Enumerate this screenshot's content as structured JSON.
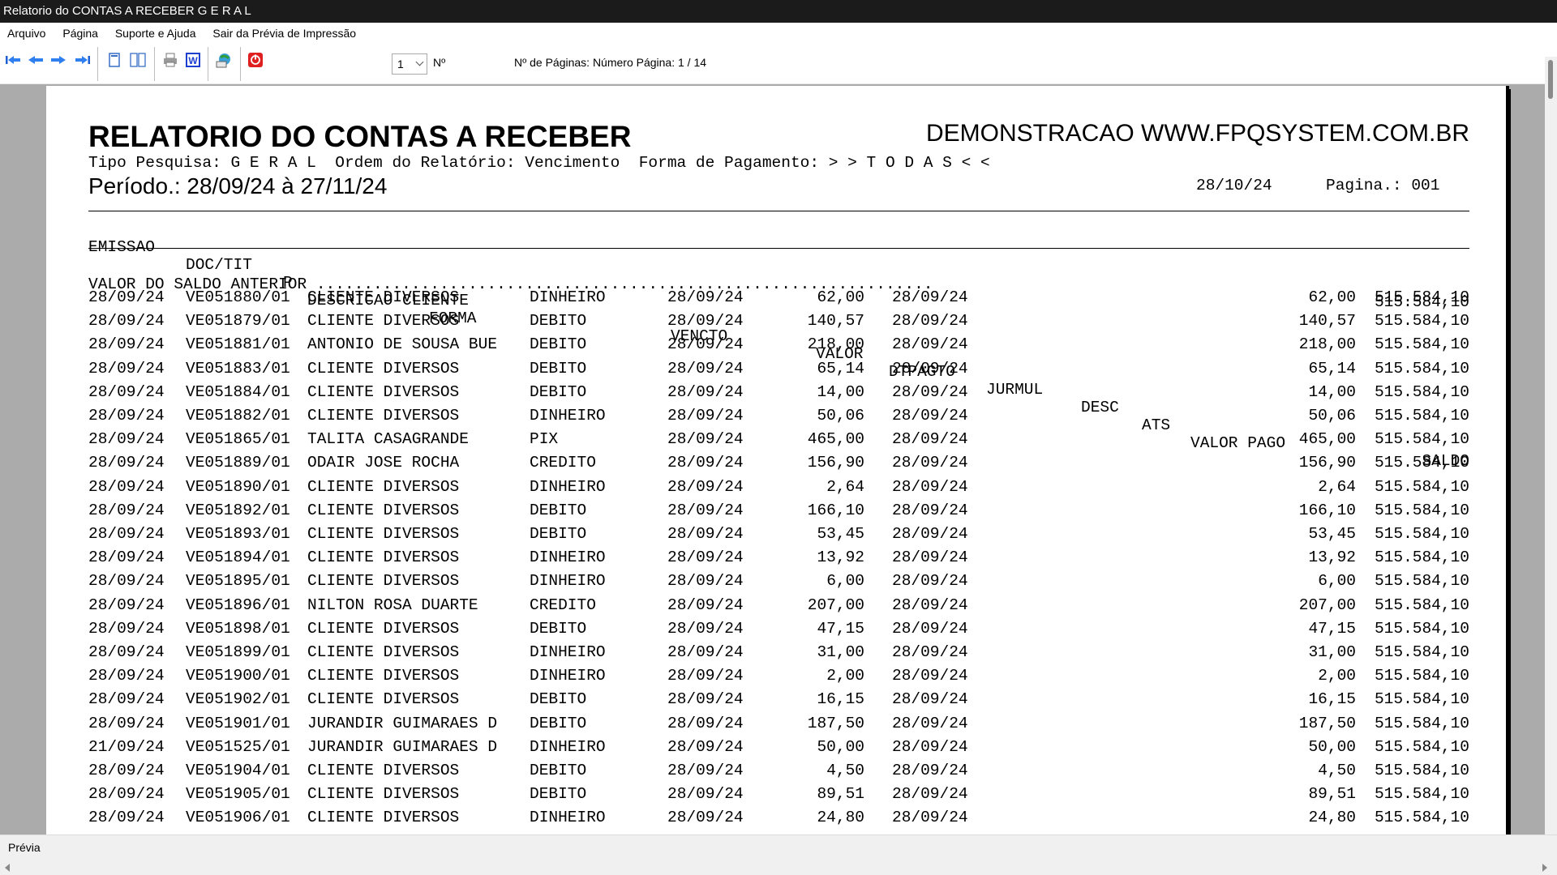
{
  "window": {
    "title": "Relatorio do CONTAS A RECEBER G E R A L"
  },
  "menu": [
    "Arquivo",
    "Página",
    "Suporte e Ajuda",
    "Sair da Prévia de Impressão"
  ],
  "toolbar": {
    "icons": [
      "first-page-icon",
      "prev-page-icon",
      "next-page-icon",
      "last-page-icon",
      "single-page-icon",
      "two-pages-icon",
      "print-icon",
      "word-export-icon",
      "email-export-icon",
      "close-preview-icon"
    ],
    "page_select_value": "1",
    "n_label": "Nº",
    "pages_info": "Nº de Páginas: Número Página: 1 / 14"
  },
  "status": {
    "text": "Prévia"
  },
  "report": {
    "title": "RELATORIO DO CONTAS A RECEBER",
    "company": "DEMONSTRACAO WWW.FPQSYSTEM.COM.BR",
    "line2": "Tipo Pesquisa: G E R A L  Ordem do Relatório: Vencimento  Forma de Pagamento: > > T O D A S < <",
    "periodo": "Período.: 28/09/24 à 27/11/24",
    "date": "28/10/24",
    "pagina": "Pagina.: 001",
    "columns": {
      "emissao": "EMISSAO",
      "doc": "DOC/TIT",
      "p": "P",
      "descricao": "DESCRICAO CLIENTE",
      "forma": "FORMA",
      "vencto": "VENCTO",
      "valor": "VALOR",
      "dtpagto": "DTPAGTO",
      "jurmul": "JURMUL",
      "desc": "DESC",
      "ats": "ATS",
      "valor_pago": "VALOR PAGO",
      "saldo": "SALDO"
    },
    "saldo_anterior": {
      "label": "VALOR DO SALDO ANTERIOR .................................................................",
      "value": "515.584,10"
    },
    "rows": [
      [
        "28/09/24",
        "VE051880/01",
        "CLIENTE DIVERSOS",
        "DINHEIRO",
        "28/09/24",
        "62,00",
        "28/09/24",
        "62,00",
        "515.584,10"
      ],
      [
        "28/09/24",
        "VE051879/01",
        "CLIENTE DIVERSOS",
        "DEBITO",
        "28/09/24",
        "140,57",
        "28/09/24",
        "140,57",
        "515.584,10"
      ],
      [
        "28/09/24",
        "VE051881/01",
        "ANTONIO DE SOUSA BUE",
        "DEBITO",
        "28/09/24",
        "218,00",
        "28/09/24",
        "218,00",
        "515.584,10"
      ],
      [
        "28/09/24",
        "VE051883/01",
        "CLIENTE DIVERSOS",
        "DEBITO",
        "28/09/24",
        "65,14",
        "28/09/24",
        "65,14",
        "515.584,10"
      ],
      [
        "28/09/24",
        "VE051884/01",
        "CLIENTE DIVERSOS",
        "DEBITO",
        "28/09/24",
        "14,00",
        "28/09/24",
        "14,00",
        "515.584,10"
      ],
      [
        "28/09/24",
        "VE051882/01",
        "CLIENTE DIVERSOS",
        "DINHEIRO",
        "28/09/24",
        "50,06",
        "28/09/24",
        "50,06",
        "515.584,10"
      ],
      [
        "28/09/24",
        "VE051865/01",
        "TALITA CASAGRANDE",
        "PIX",
        "28/09/24",
        "465,00",
        "28/09/24",
        "465,00",
        "515.584,10"
      ],
      [
        "28/09/24",
        "VE051889/01",
        "ODAIR JOSE ROCHA",
        "CREDITO",
        "28/09/24",
        "156,90",
        "28/09/24",
        "156,90",
        "515.584,10"
      ],
      [
        "28/09/24",
        "VE051890/01",
        "CLIENTE DIVERSOS",
        "DINHEIRO",
        "28/09/24",
        "2,64",
        "28/09/24",
        "2,64",
        "515.584,10"
      ],
      [
        "28/09/24",
        "VE051892/01",
        "CLIENTE DIVERSOS",
        "DEBITO",
        "28/09/24",
        "166,10",
        "28/09/24",
        "166,10",
        "515.584,10"
      ],
      [
        "28/09/24",
        "VE051893/01",
        "CLIENTE DIVERSOS",
        "DEBITO",
        "28/09/24",
        "53,45",
        "28/09/24",
        "53,45",
        "515.584,10"
      ],
      [
        "28/09/24",
        "VE051894/01",
        "CLIENTE DIVERSOS",
        "DINHEIRO",
        "28/09/24",
        "13,92",
        "28/09/24",
        "13,92",
        "515.584,10"
      ],
      [
        "28/09/24",
        "VE051895/01",
        "CLIENTE DIVERSOS",
        "DINHEIRO",
        "28/09/24",
        "6,00",
        "28/09/24",
        "6,00",
        "515.584,10"
      ],
      [
        "28/09/24",
        "VE051896/01",
        "NILTON ROSA DUARTE",
        "CREDITO",
        "28/09/24",
        "207,00",
        "28/09/24",
        "207,00",
        "515.584,10"
      ],
      [
        "28/09/24",
        "VE051898/01",
        "CLIENTE DIVERSOS",
        "DEBITO",
        "28/09/24",
        "47,15",
        "28/09/24",
        "47,15",
        "515.584,10"
      ],
      [
        "28/09/24",
        "VE051899/01",
        "CLIENTE DIVERSOS",
        "DINHEIRO",
        "28/09/24",
        "31,00",
        "28/09/24",
        "31,00",
        "515.584,10"
      ],
      [
        "28/09/24",
        "VE051900/01",
        "CLIENTE DIVERSOS",
        "DINHEIRO",
        "28/09/24",
        "2,00",
        "28/09/24",
        "2,00",
        "515.584,10"
      ],
      [
        "28/09/24",
        "VE051902/01",
        "CLIENTE DIVERSOS",
        "DEBITO",
        "28/09/24",
        "16,15",
        "28/09/24",
        "16,15",
        "515.584,10"
      ],
      [
        "28/09/24",
        "VE051901/01",
        "JURANDIR GUIMARAES D",
        "DEBITO",
        "28/09/24",
        "187,50",
        "28/09/24",
        "187,50",
        "515.584,10"
      ],
      [
        "21/09/24",
        "VE051525/01",
        "JURANDIR GUIMARAES D",
        "DINHEIRO",
        "28/09/24",
        "50,00",
        "28/09/24",
        "50,00",
        "515.584,10"
      ],
      [
        "28/09/24",
        "VE051904/01",
        "CLIENTE DIVERSOS",
        "DEBITO",
        "28/09/24",
        "4,50",
        "28/09/24",
        "4,50",
        "515.584,10"
      ],
      [
        "28/09/24",
        "VE051905/01",
        "CLIENTE DIVERSOS",
        "DEBITO",
        "28/09/24",
        "89,51",
        "28/09/24",
        "89,51",
        "515.584,10"
      ],
      [
        "28/09/24",
        "VE051906/01",
        "CLIENTE DIVERSOS",
        "DINHEIRO",
        "28/09/24",
        "24,80",
        "28/09/24",
        "24,80",
        "515.584,10"
      ]
    ]
  }
}
